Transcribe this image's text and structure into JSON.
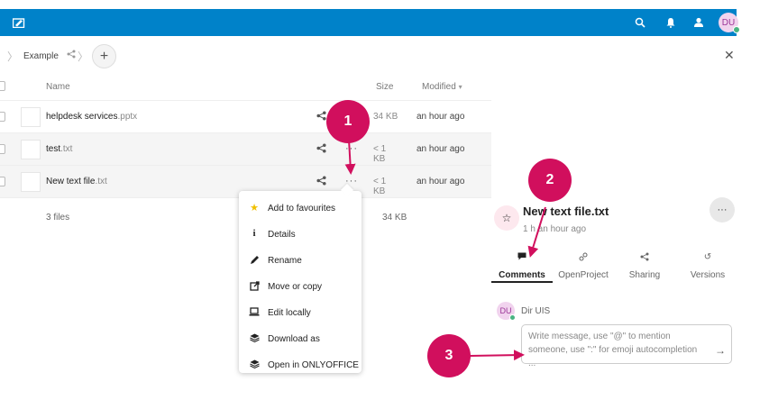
{
  "colors": {
    "header": "#0082c9",
    "badge": "#d10f5d",
    "online": "#49b382"
  },
  "header": {
    "logo_icon": "files-app-icon",
    "icons": [
      "search-icon",
      "notifications-icon",
      "contacts-icon"
    ],
    "avatar_initials": "DU"
  },
  "breadcrumb": {
    "folder": "Example",
    "add_label": "+"
  },
  "table": {
    "headers": {
      "name": "Name",
      "size": "Size",
      "modified": "Modified"
    },
    "rows": [
      {
        "base": "helpdesk services",
        "ext": ".pptx",
        "size": "34 KB",
        "modified": "an hour ago"
      },
      {
        "base": "test",
        "ext": ".txt",
        "size": "< 1 KB",
        "modified": "an hour ago"
      },
      {
        "base": "New text file",
        "ext": ".txt",
        "size": "< 1 KB",
        "modified": "an hour ago"
      }
    ],
    "summary": {
      "count": "3 files",
      "total": "34 KB"
    }
  },
  "context_menu": [
    {
      "icon": "star-icon",
      "label": "Add to favourites"
    },
    {
      "icon": "info-icon",
      "label": "Details"
    },
    {
      "icon": "pencil-icon",
      "label": "Rename"
    },
    {
      "icon": "move-icon",
      "label": "Move or copy"
    },
    {
      "icon": "laptop-icon",
      "label": "Edit locally"
    },
    {
      "icon": "stack-icon",
      "label": "Download as"
    },
    {
      "icon": "stack-icon",
      "label": "Open in ONLYOFFICE"
    }
  ],
  "sidebar": {
    "title": "New text file.txt",
    "subtitle": "1 h an hour ago",
    "tabs": [
      {
        "label": "Comments",
        "icon": "comment-icon",
        "active": true
      },
      {
        "label": "OpenProject",
        "icon": "link-icon",
        "active": false
      },
      {
        "label": "Sharing",
        "icon": "share-icon",
        "active": false
      },
      {
        "label": "Versions",
        "icon": "history-icon",
        "active": false
      }
    ],
    "comment": {
      "avatar": "DU",
      "user": "Dir UIS",
      "placeholder": "Write message, use \"@\" to mention someone, use \":\" for emoji autocompletion ..."
    }
  },
  "badges": [
    "1",
    "2",
    "3"
  ]
}
